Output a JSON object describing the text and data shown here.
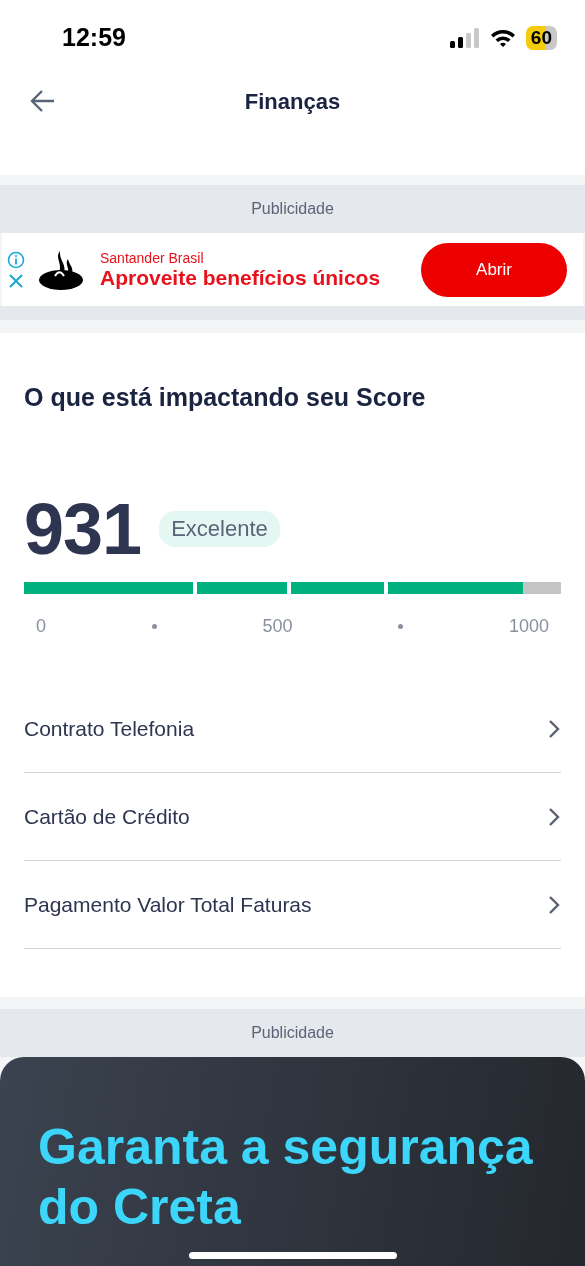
{
  "status_bar": {
    "time": "12:59",
    "battery": "60"
  },
  "header": {
    "title": "Finanças"
  },
  "ads": [
    {
      "label": "Publicidade",
      "kind": "banner",
      "advertiser": "Santander Brasil",
      "headline": "Aproveite benefícios únicos",
      "button": "Abrir"
    },
    {
      "label": "Publicidade",
      "kind": "hero",
      "headline": "Garanta a segurança do Creta"
    }
  ],
  "score_card": {
    "title": "O que está impactando seu Score",
    "score": "931",
    "rating": "Excelente",
    "level": 0.93,
    "scale": [
      "0",
      "500",
      "1000"
    ],
    "factors": [
      {
        "label": "Contrato Telefonia"
      },
      {
        "label": "Cartão de Crédito"
      },
      {
        "label": "Pagamento Valor Total Faturas"
      }
    ]
  }
}
